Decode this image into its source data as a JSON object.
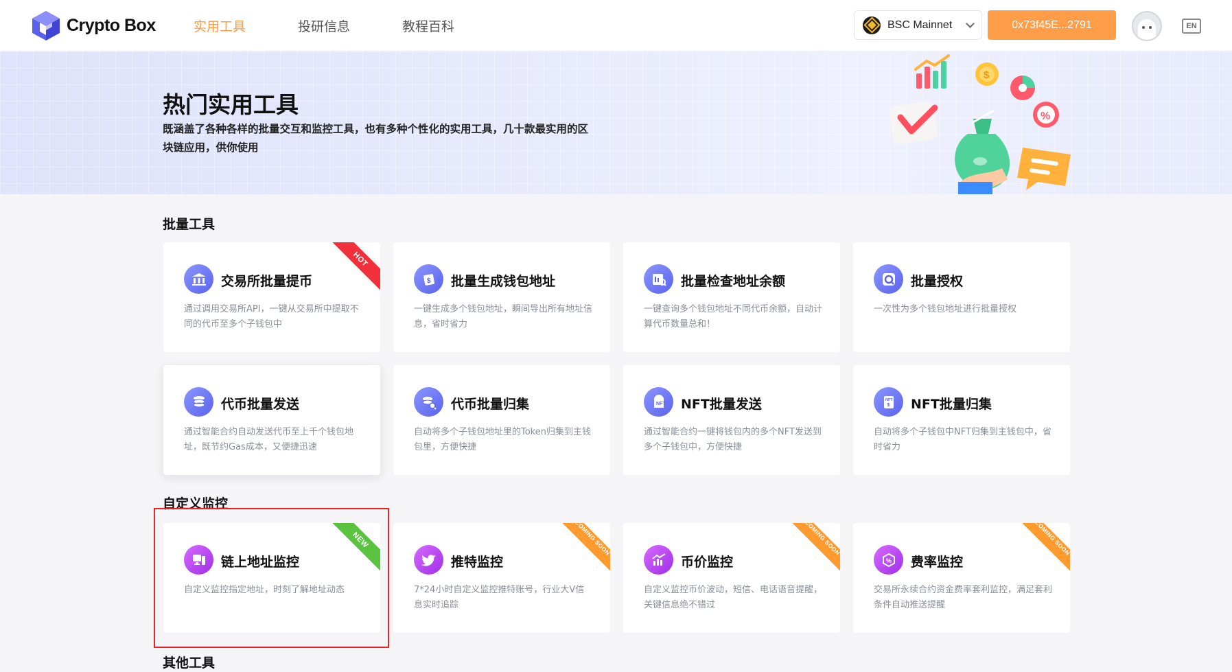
{
  "header": {
    "logo_text": "Crypto Box",
    "nav": [
      {
        "label": "实用工具",
        "active": true
      },
      {
        "label": "投研信息",
        "active": false
      },
      {
        "label": "教程百科",
        "active": false
      }
    ],
    "network": "BSC Mainnet",
    "wallet": "0x73f45E...2791",
    "lang": "EN"
  },
  "banner": {
    "title": "热门实用工具",
    "desc": "既涵盖了各种各样的批量交互和监控工具，也有多种个性化的实用工具，几十款最实用的区块链应用，供你使用"
  },
  "sections": {
    "batch": "批量工具",
    "monitor": "自定义监控",
    "other": "其他工具"
  },
  "cards": [
    {
      "title": "交易所批量提币",
      "desc": "通过调用交易所API，一键从交易所中提取不同的代币至多个子钱包中",
      "badge": "HOT",
      "icon": "bank-withdraw-icon"
    },
    {
      "title": "批量生成钱包地址",
      "desc": "一键生成多个钱包地址，瞬间导出所有地址信息，省时省力",
      "badge": "",
      "icon": "wallet-generate-icon"
    },
    {
      "title": "批量检查地址余额",
      "desc": "一键查询多个钱包地址不同代币余额，自动计算代币数量总和！",
      "badge": "",
      "icon": "balance-check-icon"
    },
    {
      "title": "批量授权",
      "desc": "一次性为多个钱包地址进行批量授权",
      "badge": "",
      "icon": "authorize-icon"
    },
    {
      "title": "代币批量发送",
      "desc": "通过智能合约自动发送代币至上千个钱包地址，既节约Gas成本，又便捷迅速",
      "badge": "",
      "icon": "coins-send-icon"
    },
    {
      "title": "代币批量归集",
      "desc": "自动将多个子钱包地址里的Token归集到主钱包里，方便快捷",
      "badge": "",
      "icon": "coins-collect-icon"
    },
    {
      "title": "NFT批量发送",
      "desc": "通过智能合约一键将钱包内的多个NFT发送到多个子钱包中，方便快捷",
      "badge": "",
      "icon": "nft-send-icon"
    },
    {
      "title": "NFT批量归集",
      "desc": "自动将多个子钱包中NFT归集到主钱包中，省时省力",
      "badge": "",
      "icon": "nft-collect-icon"
    },
    {
      "title": "链上地址监控",
      "desc": "自定义监控指定地址，时刻了解地址动态",
      "badge": "NEW",
      "icon": "address-monitor-icon"
    },
    {
      "title": "推特监控",
      "desc": "7*24小时自定义监控推特账号，行业大V信息实时追踪",
      "badge": "COMING SOON",
      "icon": "twitter-icon"
    },
    {
      "title": "币价监控",
      "desc": "自定义监控币价波动，短信、电话语音提醒，关键信息绝不错过",
      "badge": "COMING SOON",
      "icon": "price-chart-icon"
    },
    {
      "title": "费率监控",
      "desc": "交易所永续合约资金费率套利监控，满足套利条件自动推送提醒",
      "badge": "COMING SOON",
      "icon": "fee-rate-icon"
    }
  ],
  "colors": {
    "accent": "#ff9d48",
    "icon_blue": "#6e7bf2",
    "icon_purple": "#b43cf0",
    "hot": "#f0313c",
    "new": "#5ac33f",
    "soon": "#ff9a2e"
  }
}
